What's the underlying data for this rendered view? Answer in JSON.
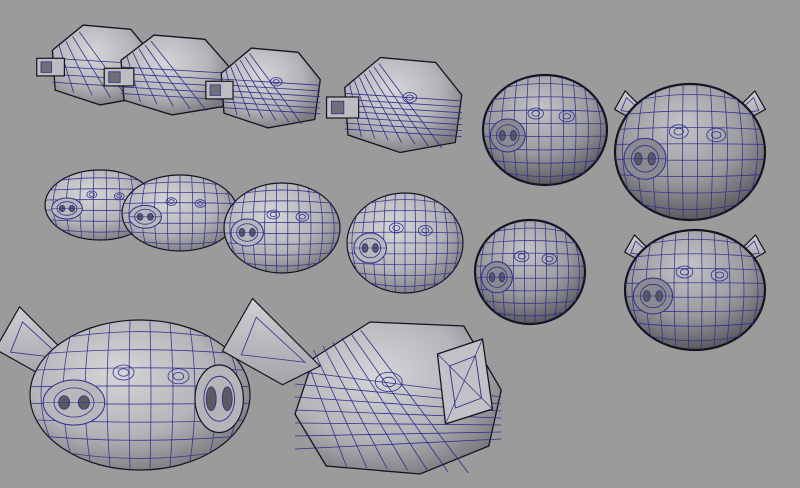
{
  "viewport": {
    "background_color": "#9b9b9b",
    "mesh_fill_light": "#c9c9cc",
    "mesh_fill_mid": "#a9a9ad",
    "mesh_fill_dark": "#6c6c70",
    "wire_color": "#2e2f8c",
    "silhouette_color": "#141420"
  },
  "models": [
    {
      "id": "cube-head",
      "icon": "cube-mesh-icon",
      "kind": "boxy",
      "ears": false
    },
    {
      "id": "boxy-head-1",
      "icon": "boxy-pig-mesh-icon",
      "kind": "boxy",
      "ears": false
    },
    {
      "id": "boxy-head-2",
      "icon": "boxy-pig-mesh-icon",
      "kind": "boxy",
      "ears": false
    },
    {
      "id": "boxy-head-3",
      "icon": "boxy-pig-mesh-icon",
      "kind": "boxy",
      "ears": false
    },
    {
      "id": "dark-head",
      "icon": "pig-head-mesh-icon",
      "kind": "round",
      "ears": false
    },
    {
      "id": "eared-head-top",
      "icon": "pig-head-ears-mesh-icon",
      "kind": "round",
      "ears": true
    },
    {
      "id": "smooth-head-1",
      "icon": "smooth-pig-mesh-icon",
      "kind": "smooth",
      "ears": false
    },
    {
      "id": "smooth-head-2",
      "icon": "smooth-pig-mesh-icon",
      "kind": "smooth",
      "ears": false
    },
    {
      "id": "smooth-head-3",
      "icon": "smooth-pig-mesh-icon",
      "kind": "smooth",
      "ears": false
    },
    {
      "id": "smooth-head-4",
      "icon": "smooth-pig-mesh-icon",
      "kind": "smooth",
      "ears": false
    },
    {
      "id": "smooth-head-5",
      "icon": "pig-head-mesh-icon",
      "kind": "round",
      "ears": false
    },
    {
      "id": "eared-head-mid",
      "icon": "pig-head-ears-mesh-icon",
      "kind": "round",
      "ears": true
    },
    {
      "id": "big-eared-head",
      "icon": "pig-head-ears-mesh-icon",
      "kind": "smooth",
      "ears": true
    },
    {
      "id": "faceted-eared-head",
      "icon": "faceted-pig-mesh-icon",
      "kind": "faceted",
      "ears": true
    }
  ]
}
